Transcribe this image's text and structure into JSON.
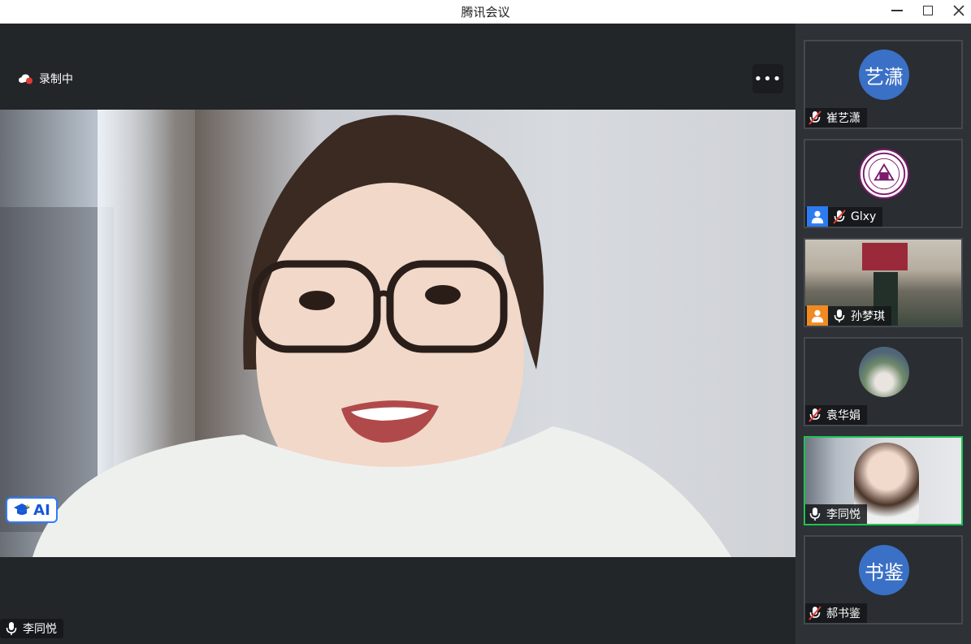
{
  "window": {
    "title": "腾讯会议"
  },
  "recording": {
    "label": "录制中"
  },
  "more": {
    "label": "•••"
  },
  "ai_badge": {
    "label": "AI"
  },
  "stage": {
    "speaker_name": "李同悦"
  },
  "participants": [
    {
      "name": "崔艺潇",
      "avatar_text": "艺潇",
      "mic": "muted"
    },
    {
      "name": "Glxy",
      "avatar_text": "",
      "mic": "muted"
    },
    {
      "name": "孙梦琪",
      "avatar_text": "",
      "mic": "on"
    },
    {
      "name": "袁华娟",
      "avatar_text": "",
      "mic": "muted"
    },
    {
      "name": "李同悦",
      "avatar_text": "",
      "mic": "on"
    },
    {
      "name": "郝书鉴",
      "avatar_text": "书鉴",
      "mic": "muted"
    }
  ],
  "colors": {
    "active_border": "#1fc454",
    "avatar_blue": "#3a70c6",
    "record_red": "#e53935"
  }
}
